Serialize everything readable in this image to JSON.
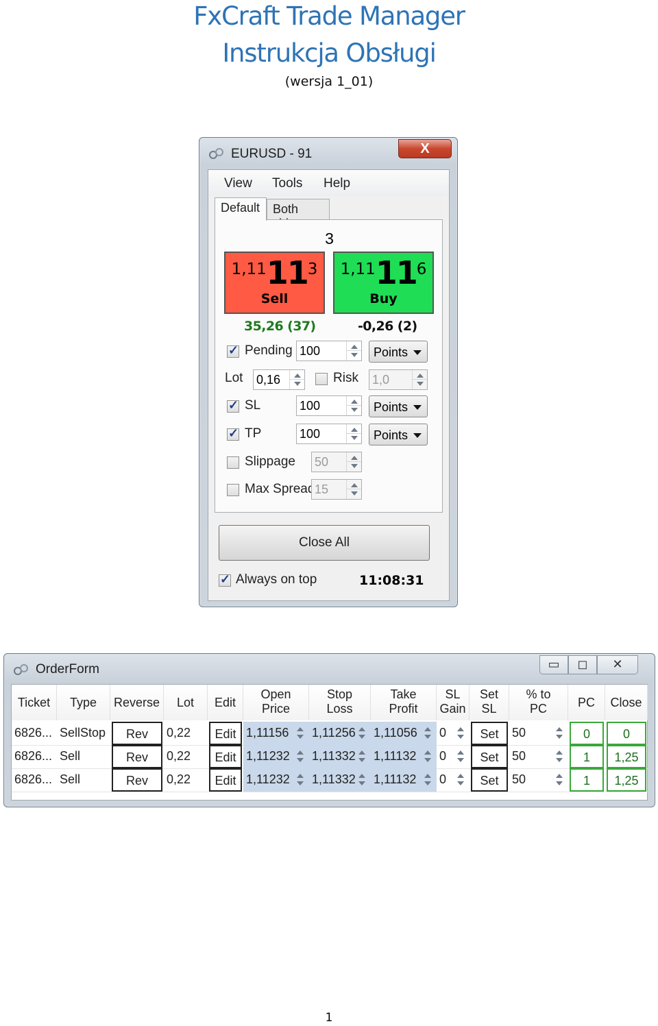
{
  "document": {
    "title_line1": "FxCraft Trade Manager",
    "title_line2": "Instrukcja Obsługi",
    "version": "(wersja 1_01)",
    "page_number": "1"
  },
  "trade_manager": {
    "window_title": "EURUSD - 91",
    "close_glyph": "X",
    "menu": [
      "View",
      "Tools",
      "Help"
    ],
    "tabs": [
      "Default",
      "Both sides"
    ],
    "spread": "3",
    "sell": {
      "prefix": "1,11",
      "big": "11",
      "suffix": "3",
      "label": "Sell",
      "color": "#ff5a43"
    },
    "buy": {
      "prefix": "1,11",
      "big": "11",
      "suffix": "6",
      "label": "Buy",
      "color": "#1fdd55"
    },
    "pnl_sell": "35,26 (37)",
    "pnl_buy": "-0,26 (2)",
    "pending": {
      "label": "Pending",
      "value": "100",
      "mode": "Points"
    },
    "lot": {
      "label": "Lot",
      "value": "0,16"
    },
    "risk": {
      "label": "Risk",
      "value": "1,0"
    },
    "sl": {
      "label": "SL",
      "value": "100",
      "mode": "Points"
    },
    "tp": {
      "label": "TP",
      "value": "100",
      "mode": "Points"
    },
    "slippage": {
      "label": "Slippage",
      "value": "50"
    },
    "max_spread": {
      "label": "Max Spread",
      "value": "15"
    },
    "close_all": "Close All",
    "always_on_top": "Always on top",
    "clock": "11:08:31"
  },
  "order_form": {
    "window_title": "OrderForm",
    "headers": [
      [
        "Ticket"
      ],
      [
        "Type"
      ],
      [
        "Reverse"
      ],
      [
        "Lot"
      ],
      [
        "Edit"
      ],
      [
        "Open",
        "Price"
      ],
      [
        "Stop",
        "Loss"
      ],
      [
        "Take",
        "Profit"
      ],
      [
        "SL",
        "Gain"
      ],
      [
        "Set",
        "SL"
      ],
      [
        "% to",
        "PC"
      ],
      [
        "PC"
      ],
      [
        "Close"
      ]
    ],
    "rows": [
      {
        "ticket": "6826...",
        "type": "SellStop",
        "reverse": "Rev",
        "lot": "0,22",
        "edit": "Edit",
        "open": "1,11156",
        "sl": "1,11256",
        "tp": "1,11056",
        "sl_gain": "0",
        "set_sl": "Set",
        "pct_pc": "50",
        "pc": "0",
        "close": "0"
      },
      {
        "ticket": "6826...",
        "type": "Sell",
        "reverse": "Rev",
        "lot": "0,22",
        "edit": "Edit",
        "open": "1,11232",
        "sl": "1,11332",
        "tp": "1,11132",
        "sl_gain": "0",
        "set_sl": "Set",
        "pct_pc": "50",
        "pc": "1",
        "close": "1,25"
      },
      {
        "ticket": "6826...",
        "type": "Sell",
        "reverse": "Rev",
        "lot": "0,22",
        "edit": "Edit",
        "open": "1,11232",
        "sl": "1,11332",
        "tp": "1,11132",
        "sl_gain": "0",
        "set_sl": "Set",
        "pct_pc": "50",
        "pc": "1",
        "close": "1,25"
      }
    ]
  }
}
